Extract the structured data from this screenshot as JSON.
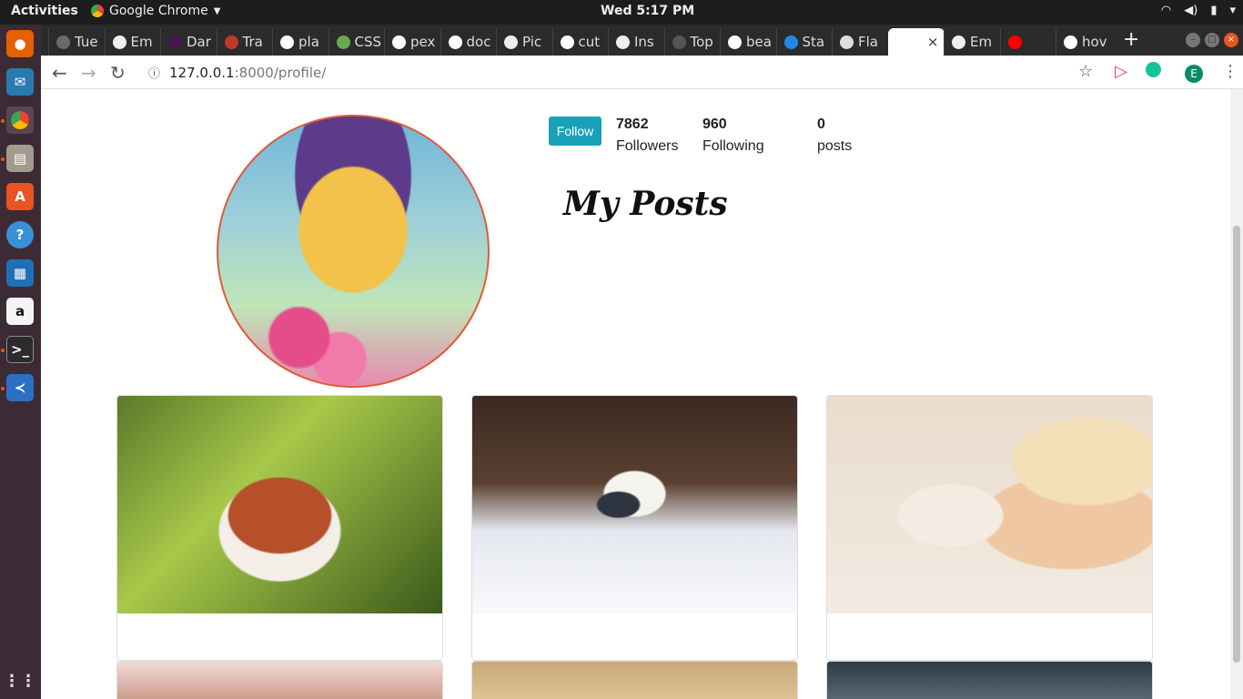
{
  "topbar": {
    "activities": "Activities",
    "app_name": "Google Chrome",
    "clock": "Wed  5:17 PM"
  },
  "tabs": [
    {
      "label": "Tue",
      "color": "#6b6b6b"
    },
    {
      "label": "Em",
      "color": "#eeeeee"
    },
    {
      "label": "Dar",
      "color": "#4a154b"
    },
    {
      "label": "Tra",
      "color": "#c0392b"
    },
    {
      "label": "pla",
      "color": "#ffffff"
    },
    {
      "label": "CSS",
      "color": "#6aa84f"
    },
    {
      "label": "pex",
      "color": "#ffffff"
    },
    {
      "label": "doc",
      "color": "#ffffff"
    },
    {
      "label": "Pic",
      "color": "#eeeeee"
    },
    {
      "label": "cut",
      "color": "#ffffff"
    },
    {
      "label": "Ins",
      "color": "#eeeeee"
    },
    {
      "label": "Top",
      "color": "#555555"
    },
    {
      "label": "bea",
      "color": "#ffffff"
    },
    {
      "label": "Sta",
      "color": "#1e88e5"
    },
    {
      "label": "Fla",
      "color": "#dddddd"
    },
    {
      "label": "",
      "color": "#ffffff",
      "active": true
    },
    {
      "label": "Em",
      "color": "#eeeeee"
    },
    {
      "label": "",
      "color": "#ff0000"
    },
    {
      "label": "hov",
      "color": "#ffffff"
    }
  ],
  "toolbar": {
    "url_host": "127.0.0.1",
    "url_rest": ":8000/profile/",
    "avatar_letter": "E"
  },
  "profile": {
    "follow_label": "Follow",
    "followers_count": "7862",
    "followers_label": "Followers",
    "following_count": "960",
    "following_label": "Following",
    "posts_count": "0",
    "posts_label": "posts",
    "section_title": "My Posts"
  },
  "colors": {
    "follow_button": "#17a2b8",
    "dock_bg": "#3c2b35",
    "tabstrip_bg": "#2b2b2b"
  }
}
